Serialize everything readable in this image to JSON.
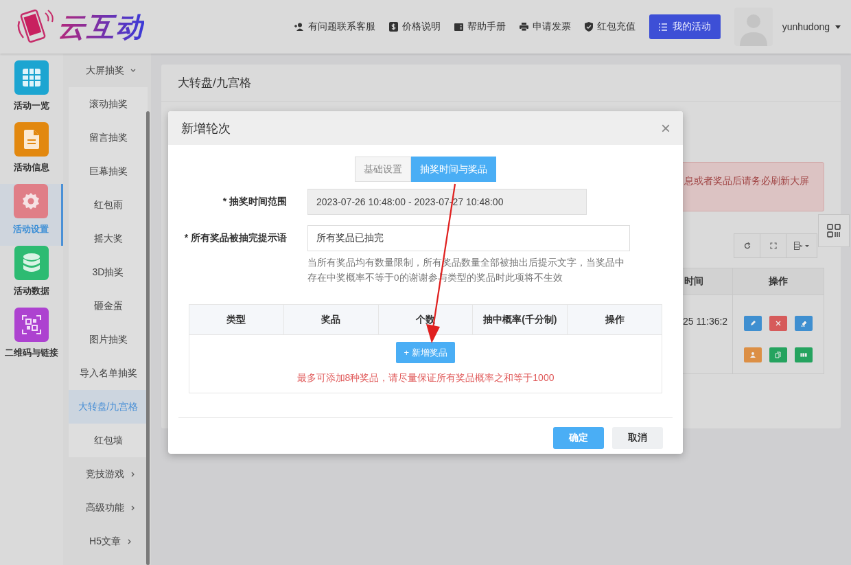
{
  "header": {
    "logo_text": "云互动",
    "nav": [
      {
        "label": "有问题联系客服"
      },
      {
        "label": "价格说明"
      },
      {
        "label": "帮助手册"
      },
      {
        "label": "申请发票"
      },
      {
        "label": "红包充值"
      }
    ],
    "activity_button": "我的活动",
    "username": "yunhudong"
  },
  "sidebar": {
    "items": [
      {
        "label": "活动一览",
        "color": "#1ca5d1",
        "selected": false
      },
      {
        "label": "活动信息",
        "color": "#e2880f",
        "selected": false
      },
      {
        "label": "活动设置",
        "color": "#e07e87",
        "selected": true
      },
      {
        "label": "活动数据",
        "color": "#2dbb72",
        "selected": false
      },
      {
        "label": "二维码与链接",
        "color": "#ad42d0",
        "selected": false
      }
    ]
  },
  "submenu": {
    "items": [
      {
        "label": "大屏抽奖",
        "kind": "group",
        "expanded": true,
        "children": [
          {
            "label": "滚动抽奖",
            "selected": false
          },
          {
            "label": "留言抽奖",
            "selected": false
          },
          {
            "label": "巨幕抽奖",
            "selected": false
          },
          {
            "label": "红包雨",
            "selected": false
          },
          {
            "label": "摇大奖",
            "selected": false
          },
          {
            "label": "3D抽奖",
            "selected": false
          },
          {
            "label": "砸金蛋",
            "selected": false
          },
          {
            "label": "图片抽奖",
            "selected": false
          },
          {
            "label": "导入名单抽奖",
            "selected": false
          },
          {
            "label": "大转盘/九宫格",
            "selected": true
          },
          {
            "label": "红包墙",
            "selected": false
          }
        ]
      },
      {
        "label": "竞技游戏",
        "kind": "group",
        "expanded": false
      },
      {
        "label": "高级功能",
        "kind": "group",
        "expanded": false
      },
      {
        "label": "H5文章",
        "kind": "group",
        "expanded": false
      }
    ]
  },
  "page": {
    "title": "大转盘/九宫格",
    "alert": "息或者奖品后请务必刷新大屏",
    "table": {
      "columns": [
        "时间",
        "操作"
      ],
      "rows": [
        {
          "cells": [
            "25 11:36:2"
          ],
          "actions": [
            {
              "color": "#3f8fd0"
            },
            {
              "color": "#d65b5b"
            },
            {
              "color": "#3f8fd0"
            },
            {
              "color": "#dc8f45"
            },
            {
              "color": "#25a35f"
            },
            {
              "color": "#25a35f"
            }
          ]
        }
      ]
    }
  },
  "modal": {
    "title": "新增轮次",
    "close": "×",
    "tabs": [
      {
        "label": "基础设置",
        "selected": false
      },
      {
        "label": "抽奖时间与奖品",
        "selected": true
      }
    ],
    "fields": [
      {
        "label": "* 抽奖时间范围",
        "value": "2023-07-26 10:48:00 - 2023-07-27 10:48:00",
        "disabled": true
      },
      {
        "label": "* 所有奖品被抽完提示语",
        "value": "所有奖品已抽完",
        "disabled": false,
        "help": "当所有奖品均有数量限制，所有奖品数量全部被抽出后提示文字，当奖品中存在中奖概率不等于0的谢谢参与类型的奖品时此项将不生效"
      }
    ],
    "prize_table": {
      "columns": [
        "类型",
        "奖品",
        "个数",
        "抽中概率(千分制)",
        "操作"
      ],
      "add_button": "+ 新增奖品",
      "note": "最多可添加8种奖品，请尽量保证所有奖品概率之和等于1000"
    },
    "buttons": [
      {
        "label": "确定",
        "kind": "primary"
      },
      {
        "label": "取消",
        "kind": "default"
      }
    ]
  }
}
